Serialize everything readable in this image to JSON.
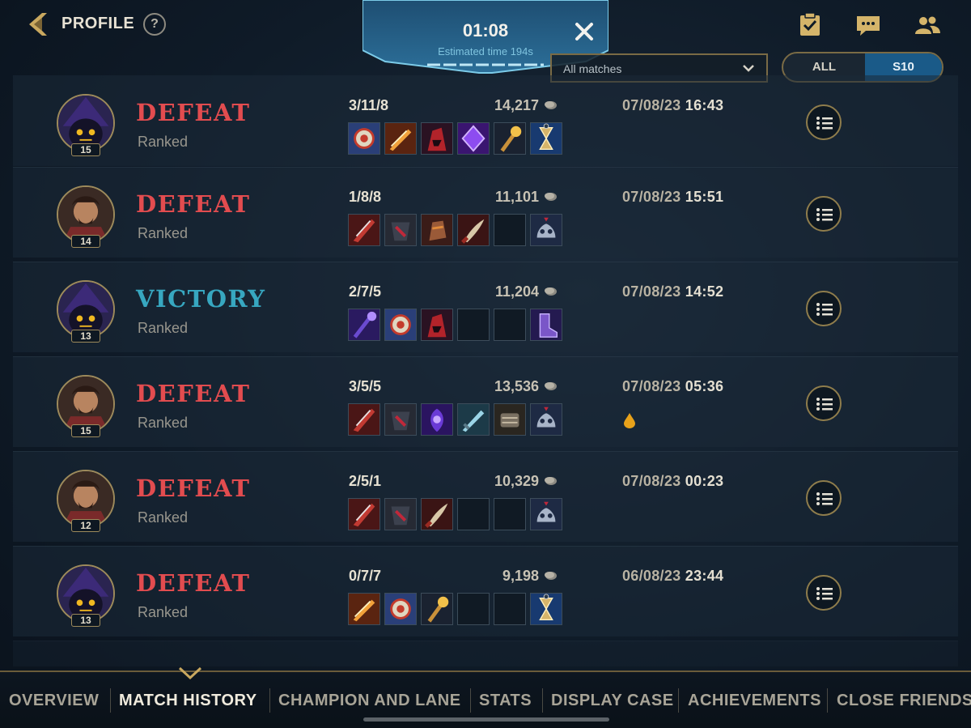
{
  "header": {
    "title": "PROFILE",
    "help_label": "?"
  },
  "timer": {
    "time": "01:08",
    "estimated": "Estimated time 194s"
  },
  "filter": {
    "selected": "All matches"
  },
  "season_toggle": {
    "all_label": "ALL",
    "season_label": "S10",
    "active": "S10"
  },
  "colors": {
    "defeat": "#e24c4f",
    "victory": "#37a7c0",
    "gold_accent": "#9d8a5b",
    "active_toggle": "#1a5a88"
  },
  "matches": [
    {
      "result": "DEFEAT",
      "queue": "Ranked",
      "level": "15",
      "champion_icon": "veigar-portrait-icon",
      "kda": "3/11/8",
      "gold": "14,217",
      "date": "07/08/23",
      "time": "16:43",
      "items": [
        "spell-orb-icon",
        "flame-blade-icon",
        "red-hood-icon",
        "void-crystal-icon",
        "golden-scepter-icon",
        "hourglass-boots-icon"
      ]
    },
    {
      "result": "DEFEAT",
      "queue": "Ranked",
      "level": "14",
      "champion_icon": "graves-portrait-icon",
      "kda": "1/8/8",
      "gold": "11,101",
      "date": "07/08/23",
      "time": "15:51",
      "items": [
        "red-blade-icon",
        "dark-armor-icon",
        "bronze-gauntlet-icon",
        "curved-dagger-icon",
        "empty-slot",
        "silver-boots-icon"
      ]
    },
    {
      "result": "VICTORY",
      "queue": "Ranked",
      "level": "13",
      "champion_icon": "veigar-portrait-icon",
      "kda": "2/7/5",
      "gold": "11,204",
      "date": "07/08/23",
      "time": "14:52",
      "items": [
        "purple-staff-icon",
        "spell-orb-icon",
        "red-hood-icon",
        "empty-slot",
        "empty-slot",
        "purple-boots-icon"
      ]
    },
    {
      "result": "DEFEAT",
      "queue": "Ranked",
      "level": "15",
      "champion_icon": "graves-portrait-icon",
      "kda": "3/5/5",
      "gold": "13,536",
      "date": "07/08/23",
      "time": "05:36",
      "has_drop_icon": true,
      "items": [
        "red-blade-icon",
        "dark-armor-icon",
        "void-spirit-icon",
        "ice-sword-icon",
        "steel-gauntlet-icon",
        "silver-boots-icon"
      ]
    },
    {
      "result": "DEFEAT",
      "queue": "Ranked",
      "level": "12",
      "champion_icon": "graves-portrait-icon",
      "kda": "2/5/1",
      "gold": "10,329",
      "date": "07/08/23",
      "time": "00:23",
      "items": [
        "red-blade-icon",
        "dark-armor-icon",
        "curved-dagger-icon",
        "empty-slot",
        "empty-slot",
        "silver-boots-icon"
      ]
    },
    {
      "result": "DEFEAT",
      "queue": "Ranked",
      "level": "13",
      "champion_icon": "veigar-portrait-icon",
      "kda": "0/7/7",
      "gold": "9,198",
      "date": "06/08/23",
      "time": "23:44",
      "items": [
        "flame-blade-icon",
        "spell-orb-icon",
        "golden-scepter-icon",
        "empty-slot",
        "empty-slot",
        "hourglass-boots-icon"
      ]
    }
  ],
  "nav": {
    "tabs": [
      "OVERVIEW",
      "MATCH HISTORY",
      "CHAMPION AND LANE",
      "STATS",
      "DISPLAY CASE",
      "ACHIEVEMENTS",
      "CLOSE FRIENDS"
    ],
    "active": "MATCH HISTORY"
  }
}
